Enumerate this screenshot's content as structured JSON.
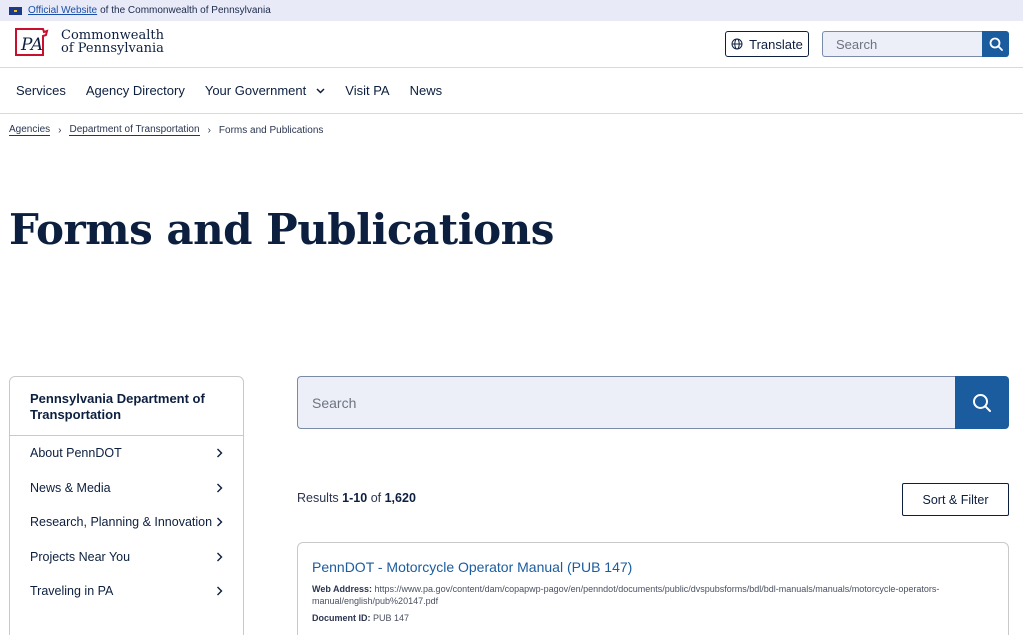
{
  "banner": {
    "link_text": "Official Website",
    "rest_text": "of the Commonwealth of Pennsylvania"
  },
  "header": {
    "logo_line1": "Commonwealth",
    "logo_line2": "of Pennsylvania",
    "translate_label": "Translate",
    "search_placeholder": "Search"
  },
  "nav": {
    "items": [
      "Services",
      "Agency Directory",
      "Your Government",
      "Visit PA",
      "News"
    ]
  },
  "breadcrumb": {
    "items": [
      "Agencies",
      "Department of Transportation",
      "Forms and Publications"
    ]
  },
  "page_title": "Forms and Publications",
  "sidebar": {
    "title": "Pennsylvania Department of Transportation",
    "items": [
      "About PennDOT",
      "News & Media",
      "Research, Planning & Innovation",
      "Projects Near You",
      "Traveling in PA"
    ]
  },
  "main_search": {
    "placeholder": "Search"
  },
  "results": {
    "prefix": "Results",
    "range": "1-10",
    "of_word": "of",
    "total": "1,620"
  },
  "sort_filter_label": "Sort & Filter",
  "result_card": {
    "title": "PennDOT - Motorcycle Operator Manual (PUB 147)",
    "web_address_label": "Web Address:",
    "web_address": "https://www.pa.gov/content/dam/copapwp-pagov/en/penndot/documents/public/dvspubsforms/bdl/bdl-manuals/manuals/motorcycle-operators-manual/english/pub%20147.pdf",
    "doc_id_label": "Document ID:",
    "doc_id": "PUB 147"
  },
  "colors": {
    "navy": "#0c1f3f",
    "accent_blue": "#1b5c9e",
    "banner_bg": "#e8eaf8",
    "input_bg": "#eceef8",
    "logo_red": "#c8102e"
  }
}
